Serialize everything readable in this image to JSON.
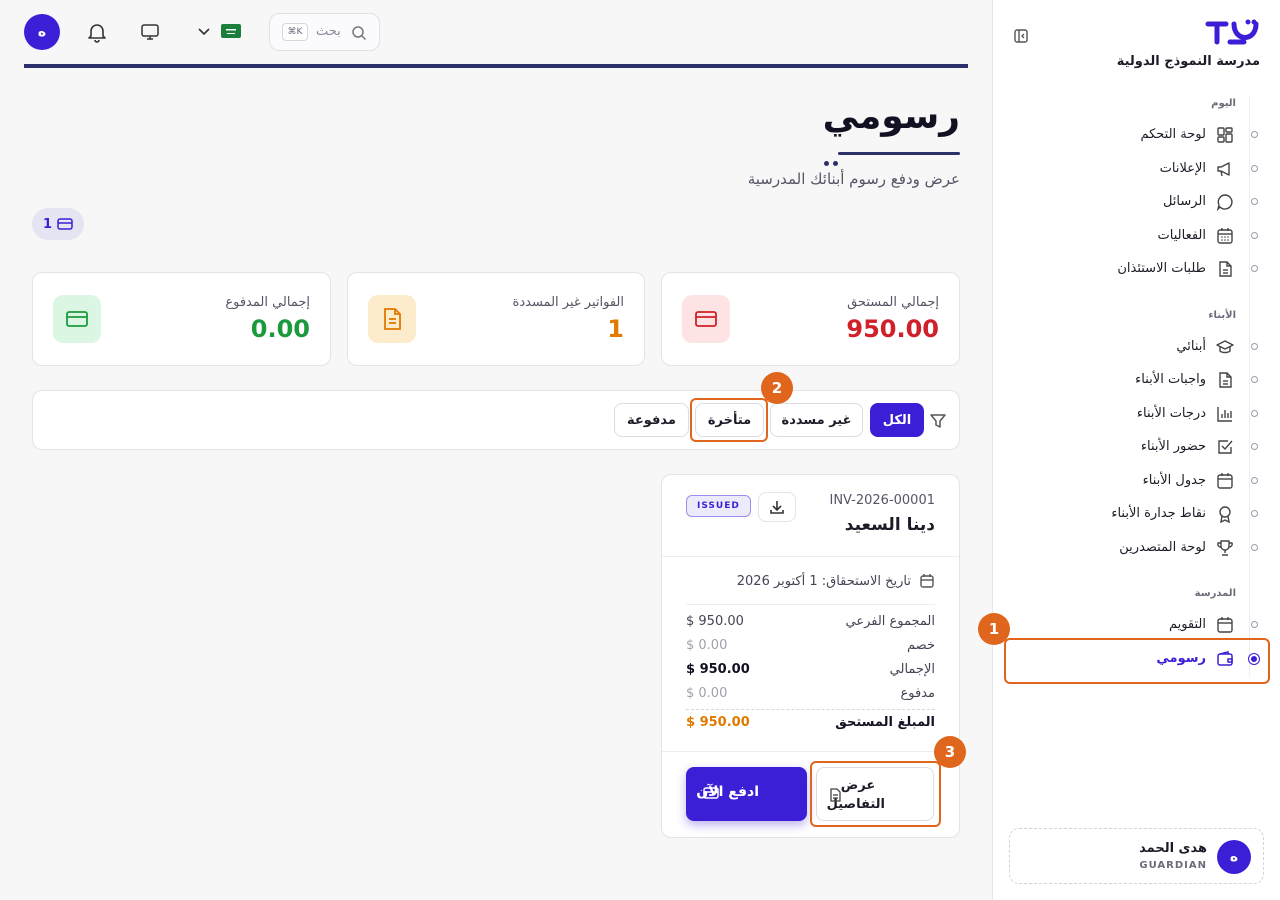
{
  "topbar": {
    "avatar_initial": "ه",
    "search_placeholder": "بحث",
    "search_shortcut": "K⌘"
  },
  "school": {
    "name": "مدرسة النموذج الدولية"
  },
  "sidebar": {
    "sections": [
      {
        "label": "اليوم",
        "items": [
          {
            "label": "لوحة التحكم",
            "icon": "dashboard-icon"
          },
          {
            "label": "الإعلانات",
            "icon": "megaphone-icon"
          },
          {
            "label": "الرسائل",
            "icon": "chat-icon"
          },
          {
            "label": "الفعاليات",
            "icon": "calendar-grid-icon"
          },
          {
            "label": "طلبات الاستئذان",
            "icon": "document-icon"
          }
        ]
      },
      {
        "label": "الأبناء",
        "items": [
          {
            "label": "أبنائي",
            "icon": "graduation-cap-icon"
          },
          {
            "label": "واجبات الأبناء",
            "icon": "document-icon"
          },
          {
            "label": "درجات الأبناء",
            "icon": "bar-chart-icon"
          },
          {
            "label": "حضور الأبناء",
            "icon": "checkbox-icon"
          },
          {
            "label": "جدول الأبناء",
            "icon": "calendar-icon"
          },
          {
            "label": "نقاط جدارة الأبناء",
            "icon": "award-icon"
          },
          {
            "label": "لوحة المتصدرين",
            "icon": "trophy-icon"
          }
        ]
      },
      {
        "label": "المدرسة",
        "items": [
          {
            "label": "التقويم",
            "icon": "calendar-icon"
          },
          {
            "label": "رسومي",
            "icon": "wallet-icon",
            "active": true
          }
        ]
      }
    ],
    "user": {
      "name": "هدى الحمد",
      "role": "GUARDIAN",
      "initial": "ه"
    }
  },
  "page": {
    "title": "رسومي",
    "subtitle": "عرض ودفع رسوم أبنائك المدرسية",
    "invoice_count": "1"
  },
  "stats": [
    {
      "label": "إجمالي المستحق",
      "value": "950.00",
      "color": "#d0202a",
      "bg": "#fde3e3",
      "icon": "credit-card-icon"
    },
    {
      "label": "الفواتير غير المسددة",
      "value": "1",
      "color": "#e07a00",
      "bg": "#fdeccb",
      "icon": "invoice-icon"
    },
    {
      "label": "إجمالي المدفوع",
      "value": "0.00",
      "color": "#1a9a3c",
      "bg": "#dcf6e4",
      "icon": "credit-card-icon"
    }
  ],
  "filters": {
    "items": [
      "الكل",
      "غير مسددة",
      "متأخرة",
      "مدفوعة"
    ],
    "active": "الكل"
  },
  "invoice": {
    "number": "INV-2026-00001",
    "student": "دينا السعيد",
    "status": "ISSUED",
    "due_date": "تاريخ الاستحقاق: 1 أكتوبر 2026",
    "rows": [
      {
        "label": "المجموع الفرعي",
        "value": "$ 950.00"
      },
      {
        "label": "خصم",
        "value": "$ 0.00"
      },
      {
        "label": "الإجمالي",
        "value": "$ 950.00"
      },
      {
        "label": "مدفوع",
        "value": "$ 0.00"
      }
    ],
    "amount_due_label": "المبلغ المستحق",
    "amount_due_value": "$ 950.00",
    "view_details": "عرض التفاصيل",
    "view_details_l1": "عرض",
    "view_details_l2": "التفاصيل",
    "pay_now": "ادفع الآن"
  },
  "annotations": [
    "1",
    "2",
    "3"
  ],
  "colors": {
    "accent": "#3b1fd6",
    "highlight": "#e0661d",
    "navy": "#2b2f6a"
  }
}
